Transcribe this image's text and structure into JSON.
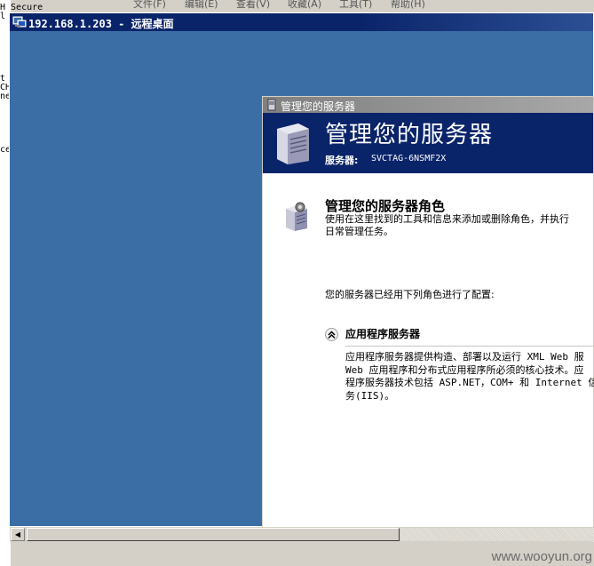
{
  "host": {
    "left_text_lines": [
      "H Secure",
      "l",
      "",
      "",
      "",
      "",
      "",
      "",
      "t",
      "CH",
      "ne",
      "",
      "",
      "",
      "",
      "",
      "ce"
    ],
    "menu": [
      "文件(F)",
      "编辑(E)",
      "查看(V)",
      "收藏(A)",
      "工具(T)",
      "帮助(H)"
    ],
    "watermark": "www.wooyun.org"
  },
  "rdp": {
    "title": "192.168.1.203 - 远程桌面",
    "icon": "remote-desktop-icon"
  },
  "mys": {
    "window_title": "管理您的服务器",
    "banner": {
      "heading": "管理您的服务器",
      "server_label": "服务器:",
      "server_name": "SVCTAG-6NSMF2X"
    },
    "roles": {
      "heading": "管理您的服务器角色",
      "desc_line1": "使用在这里找到的工具和信息来添加或删除角色，并执行",
      "desc_line2": "日常管理任务。"
    },
    "configured_text": "您的服务器已经用下列角色进行了配置:",
    "app_server": {
      "heading": "应用程序服务器",
      "desc_lines": [
        "应用程序服务器提供构造、部署以及运行 XML Web 服",
        "Web 应用程序和分布式应用程序所必须的核心技术。应",
        "程序服务器技术包括 ASP.NET，COM+ 和 Internet 信",
        "务(IIS)。"
      ]
    }
  },
  "colors": {
    "desktop_blue": "#3a6ea5",
    "title_blue": "#0a246a",
    "banner_blue": "#0a246a",
    "window_gray": "#d4d0c8"
  }
}
